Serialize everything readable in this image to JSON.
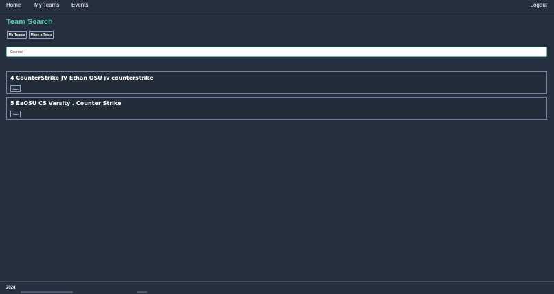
{
  "nav": {
    "home": "Home",
    "my_teams": "My Teams",
    "events": "Events",
    "logout": "Logout"
  },
  "page": {
    "title": "Team Search"
  },
  "actions": {
    "my_teams_label": "My Teams",
    "make_team_label": "Make a Team"
  },
  "search": {
    "value": "Counted",
    "placeholder": ""
  },
  "teams": [
    {
      "name": "4 CounterStrike JV Ethan OSU jv counterstrike",
      "join_label": "Join"
    },
    {
      "name": "5 EaOSU CS Varsity . Counter Strike",
      "join_label": "Join"
    }
  ],
  "footer": {
    "year": "2024"
  },
  "colors": {
    "background": "#262f3d",
    "accent": "#5cc9b3",
    "border": "#8fa3c8"
  }
}
